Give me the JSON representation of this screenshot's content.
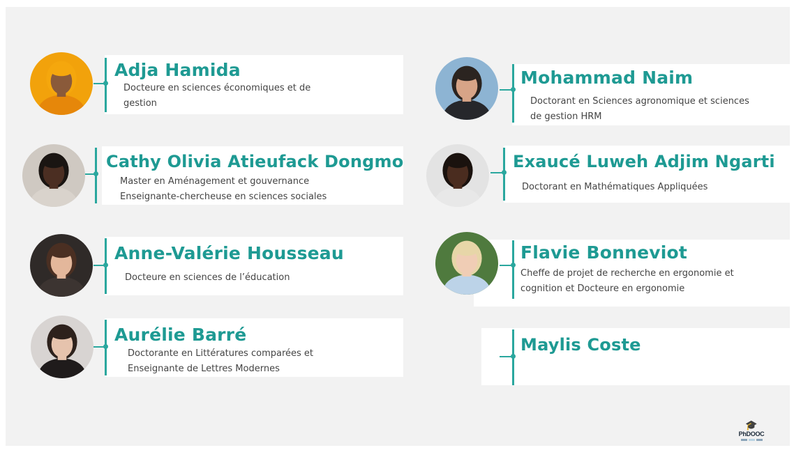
{
  "people": [
    {
      "name": "Adja Hamida",
      "lines": [
        "Docteure en sciences économiques et de",
        "gestion"
      ],
      "avatar_icon": "person-photo-icon",
      "colors": {
        "bg": "#f2a20b",
        "skin": "#8a5a3a",
        "hair": "#f5a70d",
        "cloth": "#e6870a"
      }
    },
    {
      "name": "Cathy Olivia Atieufack Dongmo",
      "lines": [
        "Master en Aménagement et gouvernance",
        "Enseignante-chercheuse en sciences sociales"
      ],
      "avatar_icon": "person-photo-icon",
      "colors": {
        "bg": "#cfc9c2",
        "skin": "#4b2e22",
        "hair": "#1a1512",
        "cloth": "#d9d3cc"
      }
    },
    {
      "name": "Anne-Valérie Housseau",
      "lines": [
        "Docteure en sciences de l’éducation"
      ],
      "avatar_icon": "person-photo-icon",
      "colors": {
        "bg": "#2f2a28",
        "skin": "#e3b79b",
        "hair": "#4a2f22",
        "cloth": "#3c3431"
      }
    },
    {
      "name": "Aurélie Barré",
      "lines": [
        "Doctorante en Littératures comparées et",
        "Enseignante de Lettres Modernes"
      ],
      "avatar_icon": "person-photo-icon",
      "colors": {
        "bg": "#d8d4d2",
        "skin": "#e6c3ad",
        "hair": "#2d211c",
        "cloth": "#1f1b1b"
      }
    },
    {
      "name": "Mohammad Naim",
      "lines": [
        "Doctorant en Sciences agronomique et sciences",
        "de gestion HRM"
      ],
      "avatar_icon": "person-photo-icon",
      "colors": {
        "bg": "#8db4d3",
        "skin": "#d7a487",
        "hair": "#2b2420",
        "cloth": "#26272b"
      }
    },
    {
      "name": "Exaucé Luweh Adjim Ngarti",
      "lines": [
        "Doctorant en Mathématiques Appliquées"
      ],
      "avatar_icon": "person-photo-icon",
      "colors": {
        "bg": "#e3e3e3",
        "skin": "#4a2c1f",
        "hair": "#1a120e",
        "cloth": "#e8e8e8"
      }
    },
    {
      "name": "Flavie Bonneviot",
      "lines": [
        "Cheffe de projet de recherche en ergonomie et",
        "cognition et Docteure en ergonomie"
      ],
      "avatar_icon": "person-photo-icon",
      "colors": {
        "bg": "#4f7a3e",
        "skin": "#f0cdb5",
        "hair": "#e7d6a8",
        "cloth": "#bcd3e8"
      }
    },
    {
      "name": "Maylis Coste",
      "lines": []
    }
  ],
  "logo": {
    "brand": "PhDOOC",
    "icon": "graduation-cap-icon"
  },
  "accent_color": "#1e9a93"
}
